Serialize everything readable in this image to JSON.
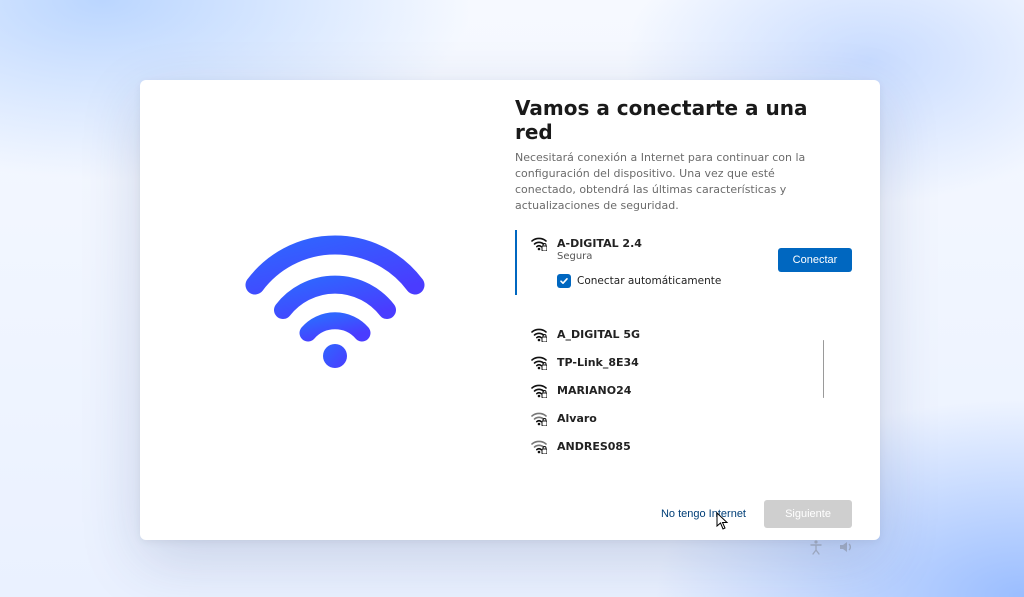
{
  "heading": "Vamos a conectarte a una red",
  "subtext": "Necesitará conexión a Internet para continuar con la configuración del dispositivo. Una vez que esté conectado, obtendrá las últimas características y actualizaciones de seguridad.",
  "selected_network": {
    "name": "A-DIGITAL 2.4",
    "security": "Segura",
    "auto_label": "Conectar automáticamente",
    "auto_checked": true
  },
  "connect_label": "Conectar",
  "networks": [
    {
      "name": "A_DIGITAL 5G"
    },
    {
      "name": "TP-Link_8E34"
    },
    {
      "name": "MARIANO24"
    },
    {
      "name": "Alvaro"
    },
    {
      "name": "ANDRES085"
    }
  ],
  "no_internet_label": "No tengo Internet",
  "next_label": "Siguiente"
}
